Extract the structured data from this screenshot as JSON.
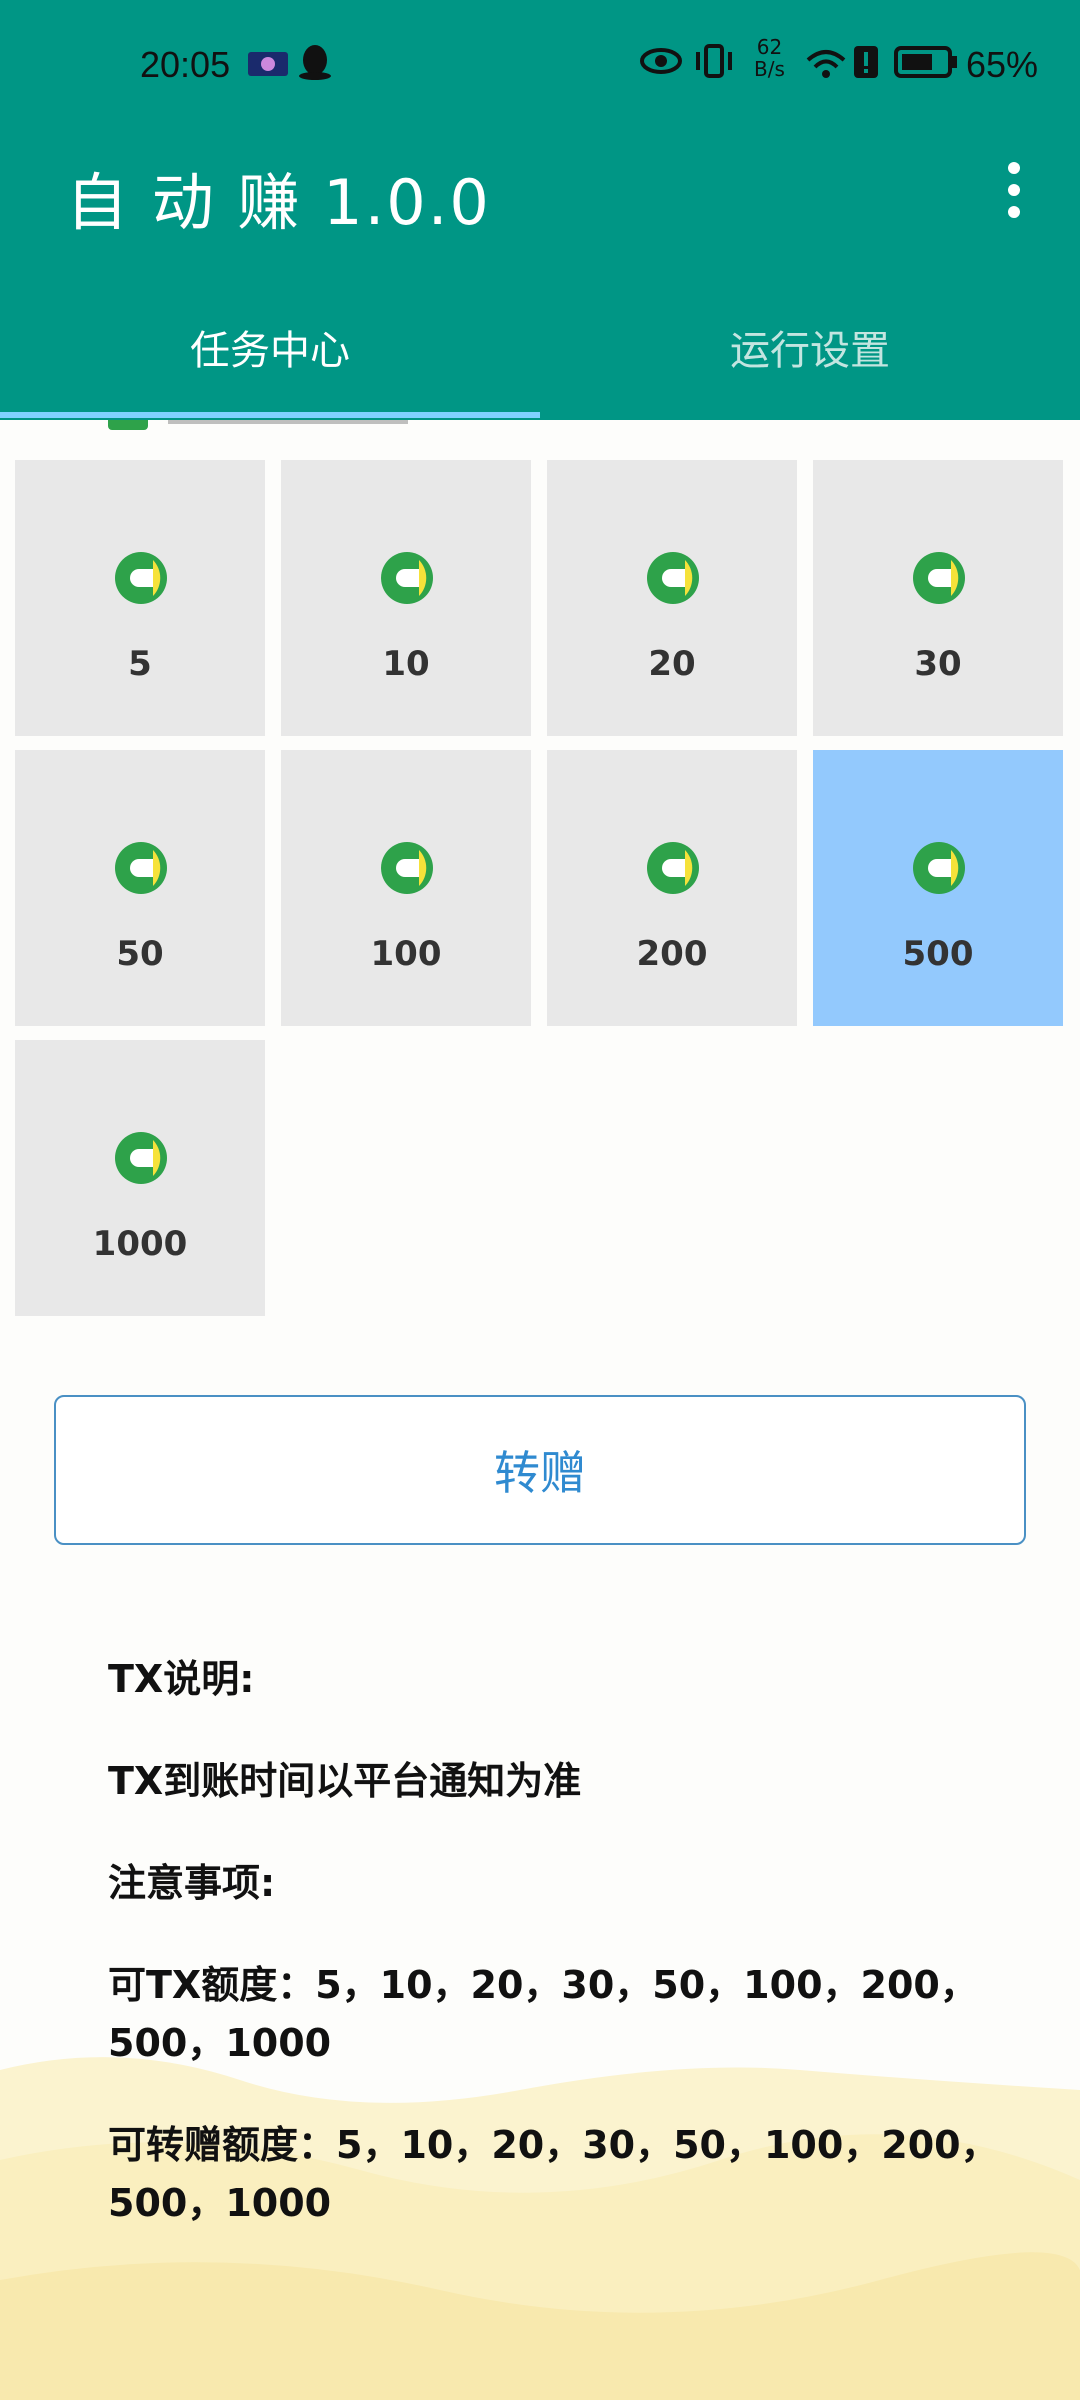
{
  "status_bar": {
    "time": "20:05",
    "net_speed_value": "62",
    "net_speed_unit": "B/s",
    "battery": "65%"
  },
  "app": {
    "title": "自 动 赚 1.0.0",
    "more_icon": "more-vert-icon"
  },
  "tabs": [
    {
      "label": "任务中心",
      "active": true
    },
    {
      "label": "运行设置",
      "active": false
    }
  ],
  "amounts": [
    {
      "label": "5",
      "selected": false
    },
    {
      "label": "10",
      "selected": false
    },
    {
      "label": "20",
      "selected": false
    },
    {
      "label": "30",
      "selected": false
    },
    {
      "label": "50",
      "selected": false
    },
    {
      "label": "100",
      "selected": false
    },
    {
      "label": "200",
      "selected": false
    },
    {
      "label": "500",
      "selected": true
    },
    {
      "label": "1000",
      "selected": false
    }
  ],
  "gift_button": "转赠",
  "notes": {
    "heading": "TX说明:",
    "line1": "TX到账时间以平台通知为准",
    "line2": "注意事项:",
    "line3": "可TX额度：5，10，20，30，50，100，200，500，1000",
    "line4": "可转赠额度：5，10，20，30，50，100，200，500，1000"
  },
  "colors": {
    "appbar": "#009685",
    "tile": "#e8e8e8",
    "tile_selected": "#93c9fd",
    "button_text": "#2f8ad0"
  }
}
